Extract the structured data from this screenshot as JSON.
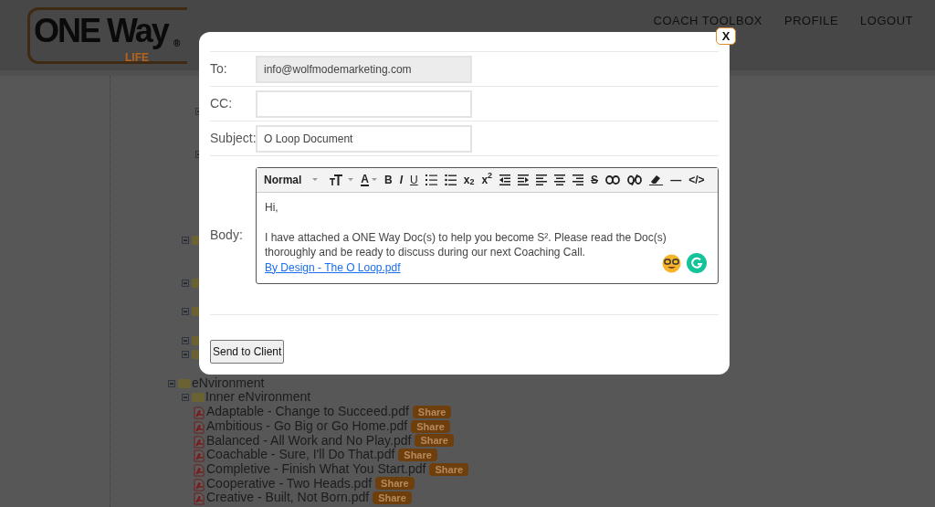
{
  "header": {
    "logo": {
      "name": "ONE Way",
      "mark": "®",
      "tagline": "LIFE"
    },
    "nav": [
      {
        "label": "COACH TOOLBOX"
      },
      {
        "label": "PROFILE"
      },
      {
        "label": "LOGOUT"
      }
    ]
  },
  "tree": [
    {
      "kind": "folder",
      "label": "eNvironment",
      "expanded": true,
      "children": [
        {
          "kind": "folder",
          "label": "Inner eNvironment",
          "expanded": true,
          "children": [
            {
              "kind": "file",
              "label": "Adaptable - Change to Succeed.pdf",
              "action": "Share"
            },
            {
              "kind": "file",
              "label": "Ambitious - Go Big or Go Home.pdf",
              "action": "Share"
            },
            {
              "kind": "file",
              "label": "Balanced - All Work and No Play.pdf",
              "action": "Share"
            },
            {
              "kind": "file",
              "label": "Coachable - Sure, I'll Do That.pdf",
              "action": "Share"
            },
            {
              "kind": "file",
              "label": "Completive - Finish What You Start.pdf",
              "action": "Share"
            },
            {
              "kind": "file",
              "label": "Cooperative - Two Heads.pdf",
              "action": "Share"
            },
            {
              "kind": "file",
              "label": "Creative - Built, Not Born.pdf",
              "action": "Share"
            }
          ]
        }
      ]
    }
  ],
  "modal": {
    "close": "X",
    "fields": [
      {
        "label": "To:",
        "value": "info@wolfmodemarketing.com",
        "disabled": true
      },
      {
        "label": "CC:",
        "disabled": false
      },
      {
        "label": "Subject:",
        "value": "O Loop Document",
        "disabled": false
      }
    ],
    "body": {
      "label": "Body:",
      "toolbar": [
        {
          "kind": "dropdown",
          "label": "Normal"
        },
        {
          "kind": "icon"
        },
        {
          "kind": "color",
          "label": "A"
        },
        {
          "kind": "text",
          "label": "B"
        },
        {
          "kind": "text",
          "label": "I"
        },
        {
          "kind": "text",
          "label": "U"
        },
        {
          "kind": "icon"
        },
        {
          "kind": "icon"
        },
        {
          "kind": "text",
          "label": "x$_{2}$"
        },
        {
          "kind": "text",
          "label": "x$^{2}$"
        },
        {
          "kind": "icon"
        },
        {
          "kind": "icon"
        },
        {
          "kind": "icon"
        },
        {
          "kind": "icon"
        },
        {
          "kind": "icon"
        },
        {
          "kind": "text",
          "label": "S"
        },
        {
          "kind": "icon"
        },
        {
          "kind": "icon"
        },
        {
          "kind": "icon"
        },
        {
          "kind": "text",
          "label": "—"
        },
        {
          "kind": "text",
          "label": "</>"
        }
      ],
      "paragraphs": [
        "Hi,",
        "I have attached a ONE Way Doc(s) to help you become S². Please read the Doc(s) thoroughly and be ready to discuss during our next Coaching Call."
      ],
      "link": "By Design - The O Loop.pdf"
    },
    "send": "Send to Client"
  }
}
